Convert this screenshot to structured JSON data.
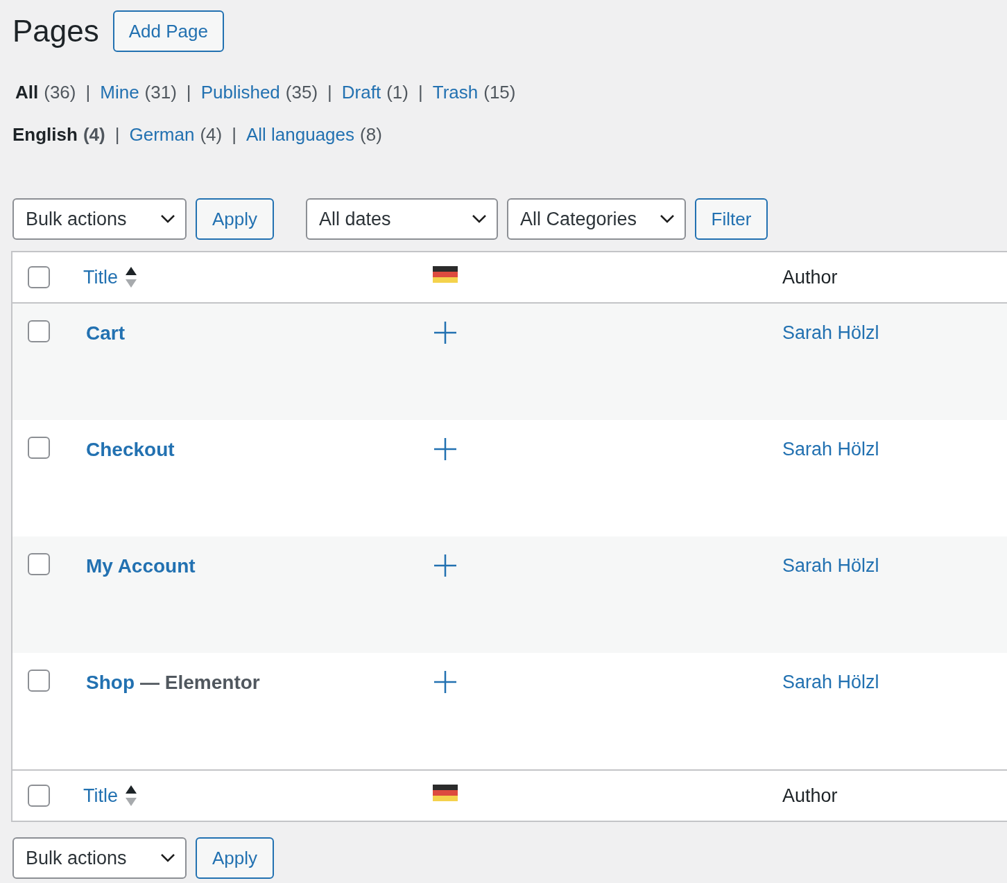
{
  "page": {
    "title": "Pages",
    "add_button": "Add Page"
  },
  "status_filters": [
    {
      "label": "All",
      "count": "(36)",
      "selected": true,
      "separator": "|"
    },
    {
      "label": "Mine",
      "count": "(31)",
      "selected": false,
      "separator": "|"
    },
    {
      "label": "Published",
      "count": "(35)",
      "selected": false,
      "separator": "|"
    },
    {
      "label": "Draft",
      "count": "(1)",
      "selected": false,
      "separator": "|"
    },
    {
      "label": "Trash",
      "count": "(15)",
      "selected": false
    }
  ],
  "language_filters": [
    {
      "label": "English",
      "count": "(4)",
      "selected": true,
      "separator": "|"
    },
    {
      "label": "German",
      "count": "(4)",
      "selected": false,
      "separator": "|"
    },
    {
      "label": "All languages",
      "count": "(8)",
      "selected": false
    }
  ],
  "top_actions": {
    "bulk": "Bulk actions",
    "apply": "Apply",
    "dates": "All dates",
    "categories": "All Categories",
    "filter": "Filter"
  },
  "table": {
    "header": {
      "title": "Title",
      "author": "Author",
      "checked": false
    },
    "rows": [
      {
        "title": "Cart",
        "author": "Sarah Hölzl",
        "checked": false
      },
      {
        "title": "Checkout",
        "author": "Sarah Hölzl",
        "checked": false
      },
      {
        "title": "My Account",
        "author": "Sarah Hölzl",
        "checked": false
      },
      {
        "title": "Shop",
        "state": "— Elementor",
        "author": "Sarah Hölzl",
        "checked": false
      }
    ],
    "footer": {
      "title": "Title",
      "author": "Author",
      "checked": false
    }
  },
  "bottom_actions": {
    "bulk": "Bulk actions",
    "apply": "Apply"
  }
}
